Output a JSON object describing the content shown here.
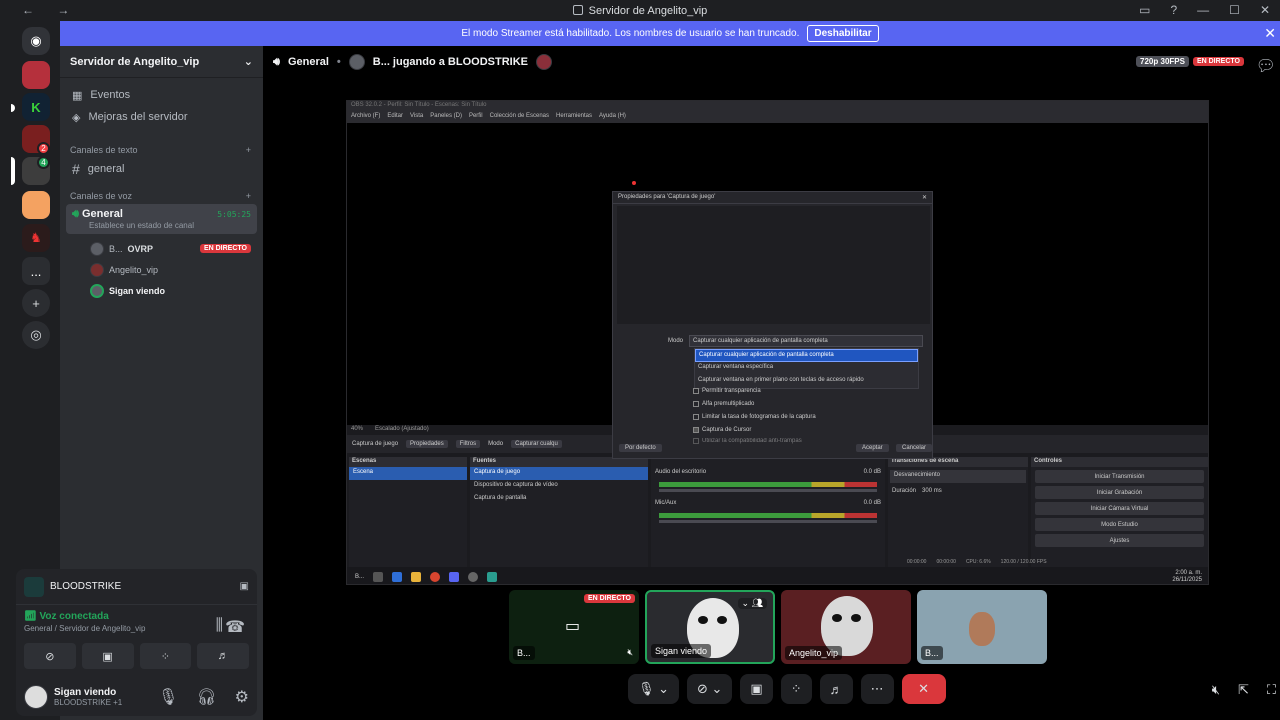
{
  "window": {
    "title": "Servidor de Angelito_vip",
    "nav": "← →"
  },
  "banner": {
    "text": "El modo Streamer está habilitado. Los nombres de usuario se han truncado.",
    "button": "Deshabilitar",
    "close": "✕"
  },
  "rail": {
    "more": "...",
    "badge_dm": "2",
    "badge_srv": "4"
  },
  "sidebar": {
    "server_name": "Servidor de Angelito_vip",
    "top_items": [
      {
        "label": "Eventos",
        "icon": "calendar-icon"
      },
      {
        "label": "Mejoras del servidor",
        "icon": "boost-icon"
      }
    ],
    "text_category": "Canales de texto",
    "text_channels": [
      {
        "label": "general"
      }
    ],
    "voice_category": "Canales de voz",
    "voice_channel": {
      "name": "General",
      "timer": "5:05:25",
      "status": "Establece un estado de canal"
    },
    "voice_users": [
      {
        "name": "B...",
        "extra": "OVRP",
        "live": "EN DIRECTO"
      },
      {
        "name": "Angelito_vip"
      },
      {
        "name": "Sigan viendo"
      }
    ]
  },
  "user_panel": {
    "game": "BLOODSTRIKE",
    "voice_status": "Voz conectada",
    "voice_server": "General / Servidor de Angelito_vip",
    "username": "Sigan viendo",
    "activity": "BLOODSTRIKE +1"
  },
  "stream": {
    "channel": "General",
    "title": "B... jugando a BLOODSTRIKE",
    "quality": "720p 30FPS",
    "live": "EN DIRECTO"
  },
  "obs": {
    "title_text": "OBS 32.0.2 - Perfil: Sin Título - Escenas: Sin Título",
    "menu": [
      "Archivo (F)",
      "Editar",
      "Vista",
      "Paneles (D)",
      "Perfil",
      "Colección de Escenas",
      "Herramientas",
      "Ayuda (H)"
    ],
    "zoom": "40%",
    "scale_mode": "Escalado (Ajustado)",
    "toolbar_source": "Captura de juego",
    "toolbar_props": "Propiedades",
    "toolbar_filters": "Filtros",
    "toolbar_mode": "Modo",
    "toolbar_mode_value": "Capturar cualqu",
    "docks": {
      "scenes": {
        "title": "Escenas",
        "items": [
          "Escena"
        ]
      },
      "sources": {
        "title": "Fuentes",
        "items": [
          "Captura de juego",
          "Dispositivo de captura de vídeo",
          "Captura de pantalla"
        ]
      },
      "mixer": {
        "ch1": "Audio del escritorio",
        "ch1_db": "0.0 dB",
        "ch2": "Mic/Aux",
        "ch2_db": "0.0 dB"
      },
      "transitions": {
        "title": "Transiciones de escena",
        "type": "Desvanecimiento",
        "dur_label": "Duración",
        "dur": "300 ms"
      },
      "controls": {
        "title": "Controles",
        "buttons": [
          "Iniciar Transmisión",
          "Iniciar Grabación",
          "Iniciar Cámara Virtual",
          "Modo Estudio",
          "Ajustes"
        ]
      }
    },
    "status": {
      "t1": "00:00:00",
      "t2": "00:00:00",
      "cpu": "CPU: 6.6%",
      "fps": "120.00 / 120.00 FPS"
    },
    "taskbar": {
      "start": "B...",
      "time": "2:00 a. m.",
      "date": "26/11/2025"
    }
  },
  "dialog": {
    "title": "Propiedades para 'Captura de juego'",
    "mode_label": "Modo",
    "mode_value": "Capturar cualquier aplicación de pantalla completa",
    "options": [
      "Capturar cualquier aplicación de pantalla completa",
      "Capturar ventana específica",
      "Capturar ventana en primer plano con teclas de acceso rápido"
    ],
    "checks": [
      "Permitir transparencia",
      "Alfa premultiplicado",
      "Limitar la tasa de fotogramas de la captura",
      "Captura de Cursor",
      "Utilizar la compatibilidad anti-trampas"
    ],
    "defaults": "Por defecto",
    "accept": "Aceptar",
    "cancel": "Cancelar"
  },
  "tiles": [
    {
      "label": "B...",
      "live": "EN DIRECTO"
    },
    {
      "label": "Sigan viendo"
    },
    {
      "label": "Angelito_vip"
    },
    {
      "label": "B..."
    }
  ]
}
